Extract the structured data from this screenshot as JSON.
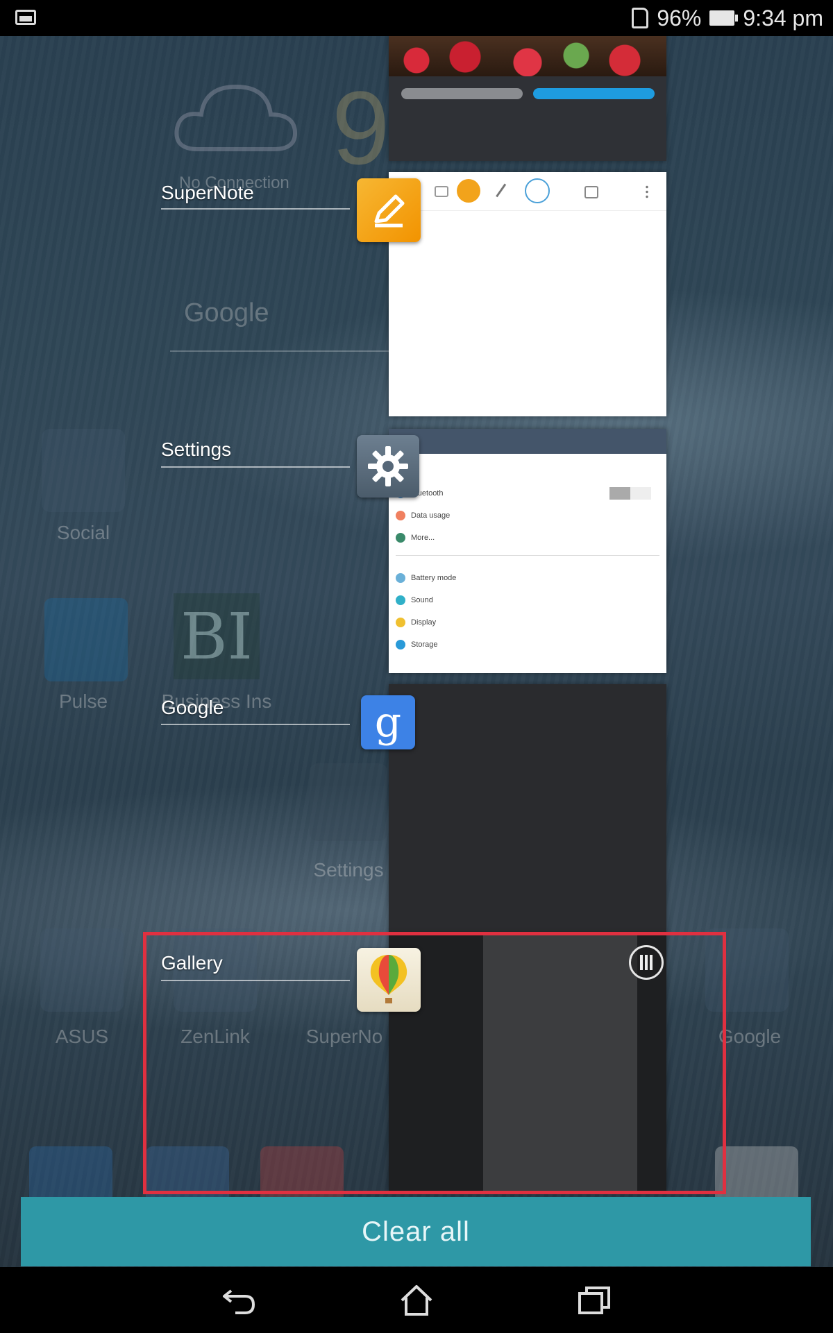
{
  "status_bar": {
    "battery_percent": "96%",
    "time": "9:34 pm"
  },
  "home_screen": {
    "clock_partial": "9",
    "weather_text": "No Connection",
    "search_label": "Google",
    "folders": [
      {
        "label": "Social"
      },
      {
        "label": "Pulse"
      },
      {
        "label": "Business Ins"
      },
      {
        "label": "Settings"
      },
      {
        "label": "ASUS"
      },
      {
        "label": "ZenLink"
      },
      {
        "label": "SuperNo"
      },
      {
        "label": "Google"
      }
    ],
    "bi_logo": "BI"
  },
  "recent_apps": [
    {
      "label": "SuperNote",
      "icon": "supernote-icon"
    },
    {
      "label": "Settings",
      "icon": "gear-icon"
    },
    {
      "label": "Google",
      "icon": "google-icon"
    },
    {
      "label": "Gallery",
      "icon": "gallery-icon"
    }
  ],
  "google_icon_letter": "g",
  "settings_preview": {
    "rows": [
      "Bluetooth",
      "Data usage",
      "More...",
      "Battery mode",
      "Sound",
      "Display",
      "Storage"
    ]
  },
  "clear_all_label": "Clear all",
  "colors": {
    "clear_all": "#2e98a6",
    "highlight": "#e03040",
    "supernote": "#f29300",
    "google": "#3d82e6"
  }
}
